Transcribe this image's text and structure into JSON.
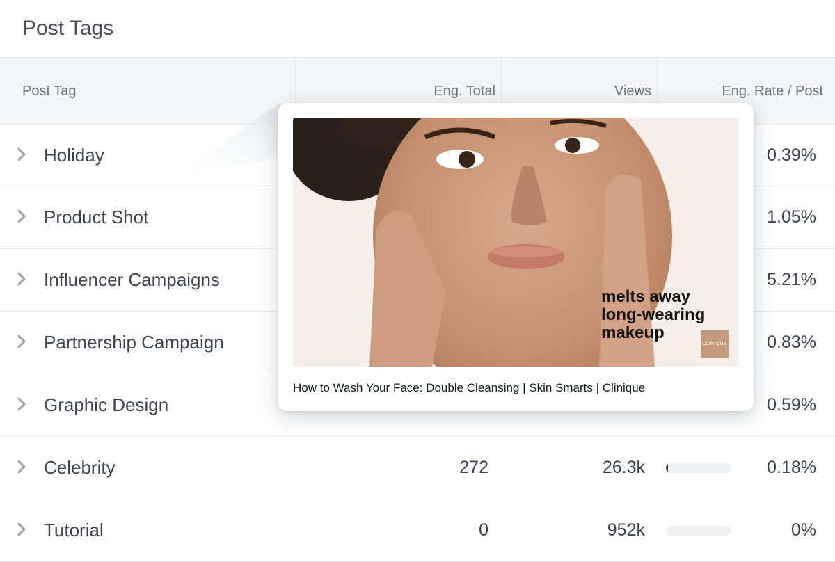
{
  "page": {
    "title": "Post Tags"
  },
  "columns": {
    "post_tag": "Post Tag",
    "eng_total": "Eng. Total",
    "views": "Views",
    "eng_rate": "Eng. Rate / Post"
  },
  "rows": [
    {
      "tag": "Holiday",
      "eng_total": "",
      "views": "",
      "rate_bar": null,
      "eng_rate": "0.39%"
    },
    {
      "tag": "Product Shot",
      "eng_total": "",
      "views": "",
      "rate_bar": null,
      "eng_rate": "1.05%"
    },
    {
      "tag": "Influencer Campaigns",
      "eng_total": "",
      "views": "",
      "rate_bar": null,
      "eng_rate": "5.21%"
    },
    {
      "tag": "Partnership Campaign",
      "eng_total": "",
      "views": "",
      "rate_bar": null,
      "eng_rate": "0.83%"
    },
    {
      "tag": "Graphic Design",
      "eng_total": "",
      "views": "",
      "rate_bar": null,
      "eng_rate": "0.59%"
    },
    {
      "tag": "Celebrity",
      "eng_total": "272",
      "views": "26.3k",
      "rate_bar": 0.03,
      "eng_rate": "0.18%"
    },
    {
      "tag": "Tutorial",
      "eng_total": "0",
      "views": "952k",
      "rate_bar": 0.0,
      "eng_rate": "0%"
    }
  ],
  "popover": {
    "caption": "How to Wash Your Face: Double Cleansing | Skin Smarts | Clinique",
    "overlay_lines": [
      "melts away",
      "long-wearing",
      "makeup"
    ],
    "brand_badge": "CLINIQUE"
  },
  "icons": {
    "row_expand": "chevron-right-icon"
  },
  "colors": {
    "text": "#3d4452",
    "header_bg": "#f3f5f7",
    "bar_track": "#eef0f3",
    "bar_fill": "#3d4452"
  }
}
